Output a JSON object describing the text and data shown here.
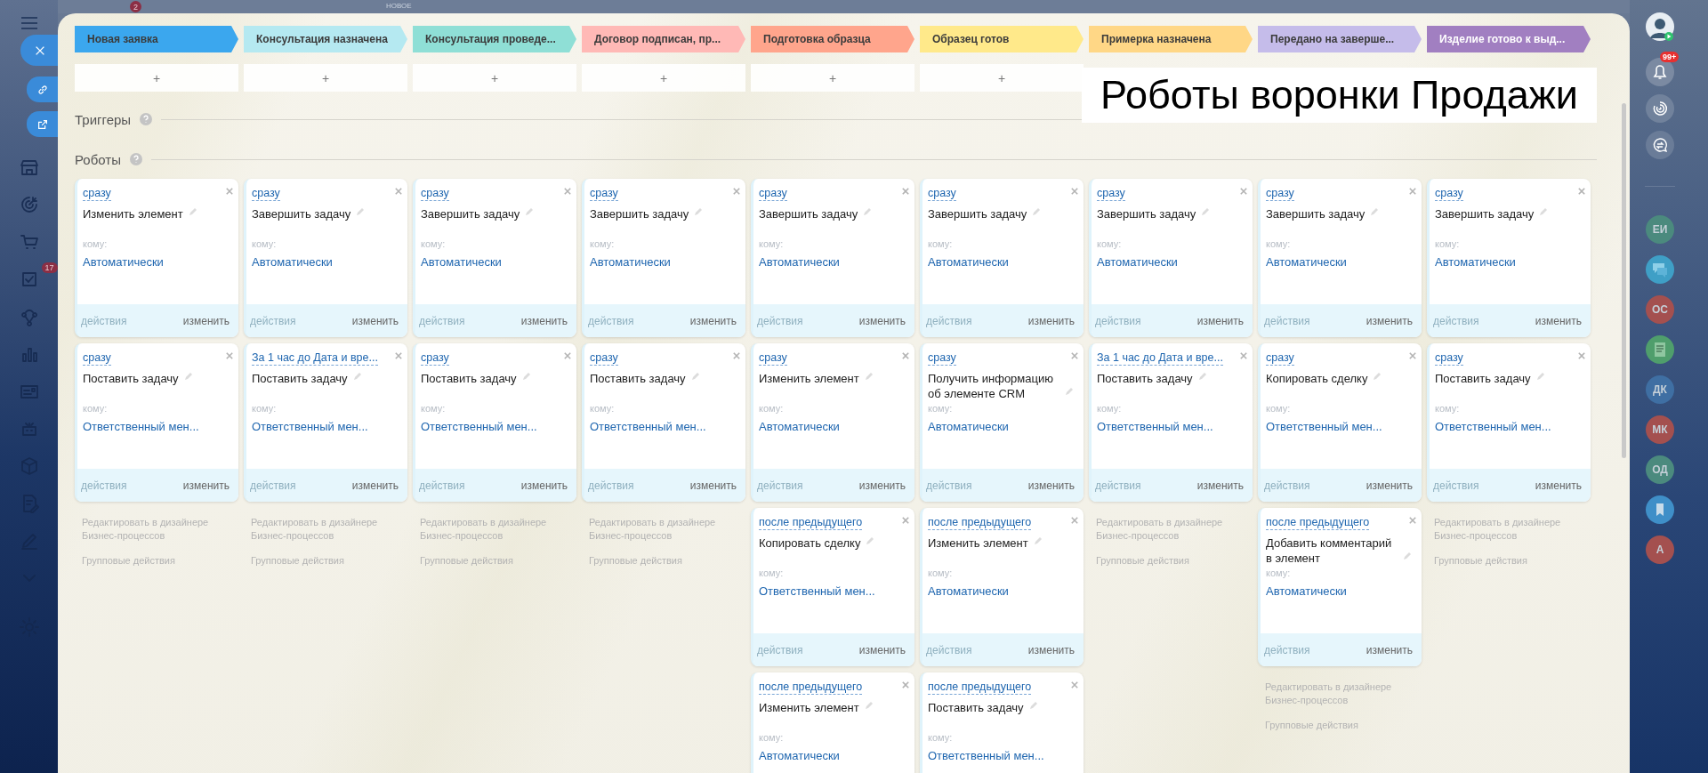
{
  "topbar": {
    "badge": "2",
    "label": "НОВОЕ"
  },
  "sidebar": {
    "tasks_badge": "17"
  },
  "stages": [
    {
      "name": "Новая заявка",
      "color": "#3ba7ee",
      "add": "+",
      "robots": [
        {
          "trigger": "сразу",
          "action": "Изменить элемент",
          "to_label": "кому:",
          "recipient": "Автоматически",
          "actions": "действия",
          "edit": "изменить"
        },
        {
          "trigger": "сразу",
          "action": "Поставить задачу",
          "to_label": "кому:",
          "recipient": "Ответственный мен...",
          "actions": "действия",
          "edit": "изменить"
        }
      ],
      "footer": {
        "edit": "Редактировать в дизайнере Бизнес-процессов",
        "group": "Групповые действия"
      }
    },
    {
      "name": "Консультация назначена",
      "color": "#b5e9f1",
      "add": "+",
      "robots": [
        {
          "trigger": "сразу",
          "action": "Завершить задачу",
          "to_label": "кому:",
          "recipient": "Автоматически",
          "actions": "действия",
          "edit": "изменить"
        },
        {
          "trigger": "За 1 час до Дата и вре...",
          "action": "Поставить задачу",
          "to_label": "кому:",
          "recipient": "Ответственный мен...",
          "actions": "действия",
          "edit": "изменить"
        }
      ],
      "footer": {
        "edit": "Редактировать в дизайнере Бизнес-процессов",
        "group": "Групповые действия"
      }
    },
    {
      "name": "Консультация проведе...",
      "color": "#8fdfd6",
      "add": "+",
      "robots": [
        {
          "trigger": "сразу",
          "action": "Завершить задачу",
          "to_label": "кому:",
          "recipient": "Автоматически",
          "actions": "действия",
          "edit": "изменить"
        },
        {
          "trigger": "сразу",
          "action": "Поставить задачу",
          "to_label": "кому:",
          "recipient": "Ответственный мен...",
          "actions": "действия",
          "edit": "изменить"
        }
      ],
      "footer": {
        "edit": "Редактировать в дизайнере Бизнес-процессов",
        "group": "Групповые действия"
      }
    },
    {
      "name": "Договор подписан, пр...",
      "color": "#ffb9b6",
      "add": "+",
      "robots": [
        {
          "trigger": "сразу",
          "action": "Завершить задачу",
          "to_label": "кому:",
          "recipient": "Автоматически",
          "actions": "действия",
          "edit": "изменить"
        },
        {
          "trigger": "сразу",
          "action": "Поставить задачу",
          "to_label": "кому:",
          "recipient": "Ответственный мен...",
          "actions": "действия",
          "edit": "изменить"
        }
      ],
      "footer": {
        "edit": "Редактировать в дизайнере Бизнес-процессов",
        "group": "Групповые действия"
      }
    },
    {
      "name": "Подготовка образца",
      "color": "#ffa58c",
      "add": "+",
      "robots": [
        {
          "trigger": "сразу",
          "action": "Завершить задачу",
          "to_label": "кому:",
          "recipient": "Автоматически",
          "actions": "действия",
          "edit": "изменить"
        },
        {
          "trigger": "сразу",
          "action": "Изменить элемент",
          "to_label": "кому:",
          "recipient": "Автоматически",
          "actions": "действия",
          "edit": "изменить"
        },
        {
          "trigger": "после предыдущего",
          "action": "Копировать сделку",
          "to_label": "кому:",
          "recipient": "Ответственный мен...",
          "actions": "действия",
          "edit": "изменить"
        },
        {
          "trigger": "после предыдущего",
          "action": "Изменить элемент",
          "to_label": "кому:",
          "recipient": "Автоматически"
        }
      ]
    },
    {
      "name": "Образец готов",
      "color": "#ffe98a",
      "add": "+",
      "robots": [
        {
          "trigger": "сразу",
          "action": "Завершить задачу",
          "to_label": "кому:",
          "recipient": "Автоматически",
          "actions": "действия",
          "edit": "изменить"
        },
        {
          "trigger": "сразу",
          "action": "Получить информацию об элементе CRM",
          "to_label": "кому:",
          "recipient": "Автоматически",
          "actions": "действия",
          "edit": "изменить"
        },
        {
          "trigger": "после предыдущего",
          "action": "Изменить элемент",
          "to_label": "кому:",
          "recipient": "Автоматически",
          "actions": "действия",
          "edit": "изменить"
        },
        {
          "trigger": "после предыдущего",
          "action": "Поставить задачу",
          "to_label": "кому:",
          "recipient": "Ответственный мен..."
        }
      ]
    },
    {
      "name": "Примерка назначена",
      "color": "#ffd786",
      "robots": [
        {
          "trigger": "сразу",
          "action": "Завершить задачу",
          "to_label": "кому:",
          "recipient": "Автоматически",
          "actions": "действия",
          "edit": "изменить"
        },
        {
          "trigger": "За 1 час до Дата и вре...",
          "action": "Поставить задачу",
          "to_label": "кому:",
          "recipient": "Ответственный мен...",
          "actions": "действия",
          "edit": "изменить"
        }
      ],
      "footer": {
        "edit": "Редактировать в дизайнере Бизнес-процессов",
        "group": "Групповые действия"
      }
    },
    {
      "name": "Передано на заверше...",
      "color": "#c5bcea",
      "robots": [
        {
          "trigger": "сразу",
          "action": "Завершить задачу",
          "to_label": "кому:",
          "recipient": "Автоматически",
          "actions": "действия",
          "edit": "изменить"
        },
        {
          "trigger": "сразу",
          "action": "Копировать сделку",
          "to_label": "кому:",
          "recipient": "Ответственный мен...",
          "actions": "действия",
          "edit": "изменить"
        },
        {
          "trigger": "после предыдущего",
          "action": "Добавить комментарий в элемент",
          "to_label": "кому:",
          "recipient": "Автоматически",
          "actions": "действия",
          "edit": "изменить"
        }
      ],
      "footer": {
        "edit": "Редактировать в дизайнере Бизнес-процессов",
        "group": "Групповые действия"
      }
    },
    {
      "name": "Изделие готово к выд...",
      "color": "#a17fc1",
      "robots": [
        {
          "trigger": "сразу",
          "action": "Завершить задачу",
          "to_label": "кому:",
          "recipient": "Автоматически",
          "actions": "действия",
          "edit": "изменить"
        },
        {
          "trigger": "сразу",
          "action": "Поставить задачу",
          "to_label": "кому:",
          "recipient": "Ответственный мен...",
          "actions": "действия",
          "edit": "изменить"
        }
      ],
      "footer": {
        "edit": "Редактировать в дизайнере Бизнес-процессов",
        "group": "Групповые действия"
      }
    }
  ],
  "sections": {
    "triggers": "Триггеры",
    "robots": "Роботы"
  },
  "overlay_title": "Роботы воронки Продажи",
  "rightbar": {
    "notifications_badge": "99+",
    "contacts": [
      {
        "kind": "initials",
        "initials": "ЕИ",
        "color": "#4b8a7e"
      },
      {
        "kind": "chat",
        "color": "#3f9fc6"
      },
      {
        "kind": "initials",
        "initials": "ОС",
        "color": "#a4504f"
      },
      {
        "kind": "document",
        "color": "#4f9e6c"
      },
      {
        "kind": "initials",
        "initials": "ДК",
        "color": "#3f6fa3"
      },
      {
        "kind": "initials",
        "initials": "МК",
        "color": "#a4504f"
      },
      {
        "kind": "initials",
        "initials": "ОД",
        "color": "#4b8a7e"
      },
      {
        "kind": "bookmark",
        "color": "#3f8fc8"
      },
      {
        "kind": "initials",
        "initials": "А",
        "color": "#a4504f"
      }
    ]
  }
}
